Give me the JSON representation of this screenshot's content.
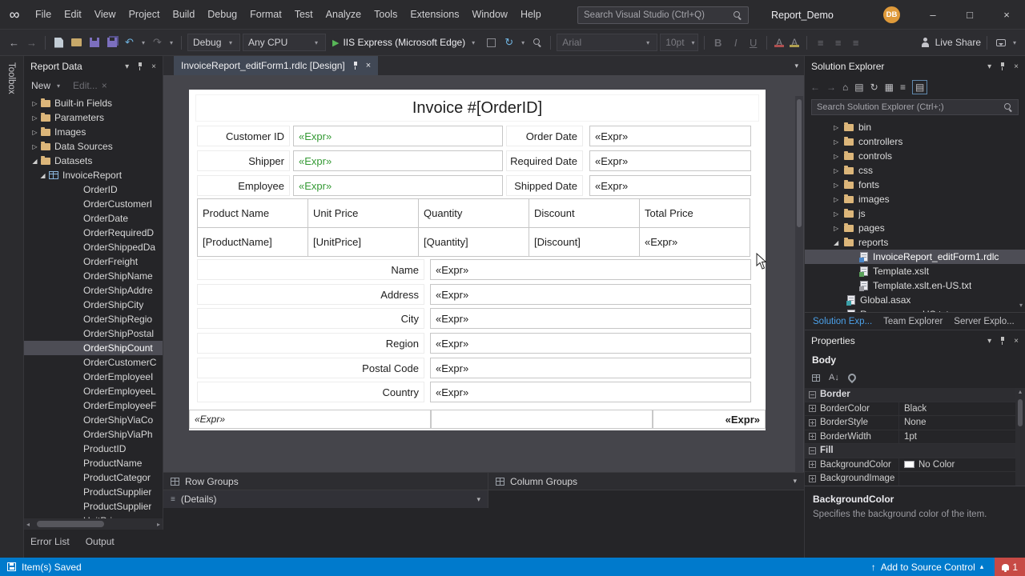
{
  "icons": {
    "dropdown": "▾",
    "dropdown_up": "▴",
    "run": "▶",
    "back": "←",
    "forward": "→",
    "undo": "↶",
    "redo": "↷",
    "refresh": "↻",
    "home": "⌂",
    "infinity": "∞",
    "close": "×",
    "minimize": "–",
    "maximize": "□",
    "collapsed": "▷",
    "expanded": "◢",
    "scroll_left": "◂",
    "scroll_right": "▸",
    "scroll_up": "▴",
    "scroll_down": "▾",
    "up_arrow": "↑",
    "lines": "≡",
    "sort_az": "A↓",
    "pending": "▤",
    "show_all": "▦"
  },
  "colors": {
    "accent": "#007acc",
    "expr_green": "#339933",
    "selection": "#4d4d55",
    "folder_yellow": "#dcb67a",
    "statusbar_blue": "#007acc",
    "notification_red": "#c74a45",
    "avatar_orange": "#df9a3a"
  },
  "titlebar": {
    "menus": [
      "File",
      "Edit",
      "View",
      "Project",
      "Build",
      "Debug",
      "Format",
      "Test",
      "Analyze",
      "Tools",
      "Extensions",
      "Window",
      "Help"
    ],
    "search_placeholder": "Search Visual Studio (Ctrl+Q)",
    "window_title": "Report_Demo",
    "avatar_initials": "DB"
  },
  "toolbar": {
    "debug_target": "Debug",
    "platform": "Any CPU",
    "run_button": "IIS Express (Microsoft Edge)",
    "font_family": "Arial",
    "font_size": "10pt",
    "bold": "B",
    "italic": "I",
    "underline": "U",
    "live_share": "Live Share"
  },
  "toolbox_label": "Toolbox",
  "report_data": {
    "title": "Report Data",
    "toolbar": {
      "new": "New",
      "edit": "Edit..."
    },
    "folders": [
      {
        "label": "Built-in Fields"
      },
      {
        "label": "Parameters"
      },
      {
        "label": "Images"
      },
      {
        "label": "Data Sources"
      },
      {
        "label": "Datasets",
        "expanded": true
      }
    ],
    "dataset": {
      "label": "InvoiceReport"
    },
    "fields": [
      "OrderID",
      "OrderCustomerI",
      "OrderDate",
      "OrderRequiredD",
      "OrderShippedDa",
      "OrderFreight",
      "OrderShipName",
      "OrderShipAddre",
      "OrderShipCity",
      "OrderShipRegio",
      "OrderShipPostal",
      "OrderShipCount",
      "OrderCustomerC",
      "OrderEmployeeI",
      "OrderEmployeeL",
      "OrderEmployeeF",
      "OrderShipViaCo",
      "OrderShipViaPh",
      "ProductID",
      "ProductName",
      "ProductCategor",
      "ProductSupplier",
      "ProductSupplier",
      "UnitPrice"
    ],
    "selected_field": "OrderShipCount"
  },
  "bottom_tabs": [
    "Error List",
    "Output"
  ],
  "editor": {
    "tab": {
      "title": "InvoiceReport_editForm1.rdlc [Design]"
    },
    "report": {
      "title": "Invoice #[OrderID]",
      "info_rows": [
        {
          "label": "Customer ID",
          "value": "«Expr»",
          "label2": "Order Date",
          "value2": "«Expr»"
        },
        {
          "label": "Shipper",
          "value": "«Expr»",
          "label2": "Required Date",
          "value2": "«Expr»"
        },
        {
          "label": "Employee",
          "value": "«Expr»",
          "label2": "Shipped Date",
          "value2": "«Expr»"
        }
      ],
      "table": {
        "headers": [
          "Product Name",
          "Unit Price",
          "Quantity",
          "Discount",
          "Total Price"
        ],
        "row": [
          "[ProductName]",
          "[UnitPrice]",
          "[Quantity]",
          "[Discount]",
          "«Expr»"
        ]
      },
      "address_rows": [
        {
          "label": "Name",
          "value": "«Expr»"
        },
        {
          "label": "Address",
          "value": "«Expr»"
        },
        {
          "label": "City",
          "value": "«Expr»"
        },
        {
          "label": "Region",
          "value": "«Expr»"
        },
        {
          "label": "Postal Code",
          "value": "«Expr»"
        },
        {
          "label": "Country",
          "value": "«Expr»"
        }
      ],
      "footer": {
        "left": "«Expr»",
        "right": "«Expr»"
      }
    },
    "groups_panel": {
      "row_groups": "Row Groups",
      "column_groups": "Column Groups",
      "row_items": [
        "(Details)"
      ]
    }
  },
  "solution_explorer": {
    "title": "Solution Explorer",
    "search_placeholder": "Search Solution Explorer (Ctrl+;)",
    "tree": [
      {
        "label": "bin",
        "kind": "folder"
      },
      {
        "label": "controllers",
        "kind": "folder"
      },
      {
        "label": "controls",
        "kind": "folder"
      },
      {
        "label": "css",
        "kind": "folder"
      },
      {
        "label": "fonts",
        "kind": "folder"
      },
      {
        "label": "images",
        "kind": "folder"
      },
      {
        "label": "js",
        "kind": "folder"
      },
      {
        "label": "pages",
        "kind": "folder"
      },
      {
        "label": "reports",
        "kind": "folder",
        "expanded": true
      },
      {
        "label": "InvoiceReport_editForm1.rdlc",
        "kind": "file-rdlc",
        "indent": 1,
        "selected": true
      },
      {
        "label": "Template.xslt",
        "kind": "file-xslt",
        "indent": 1
      },
      {
        "label": "Template.xslt.en-US.txt",
        "kind": "file-txt",
        "indent": 1
      },
      {
        "label": "Global.asax",
        "kind": "file-asax"
      },
      {
        "label": "Resources.en-US.txt",
        "kind": "file-txt"
      }
    ],
    "tabs": [
      {
        "label": "Solution Exp...",
        "active": true
      },
      {
        "label": "Team Explorer"
      },
      {
        "label": "Server Explo..."
      }
    ]
  },
  "properties": {
    "title": "Properties",
    "object_name": "Body",
    "rows": [
      {
        "kind": "category",
        "label": "Border"
      },
      {
        "kind": "prop",
        "label": "BorderColor",
        "value": "Black"
      },
      {
        "kind": "prop",
        "label": "BorderStyle",
        "value": "None"
      },
      {
        "kind": "prop",
        "label": "BorderWidth",
        "value": "1pt"
      },
      {
        "kind": "category",
        "label": "Fill"
      },
      {
        "kind": "prop",
        "label": "BackgroundColor",
        "value": "No Color",
        "swatch": true
      },
      {
        "kind": "prop",
        "label": "BackgroundImage",
        "value": ""
      }
    ],
    "description_title": "BackgroundColor",
    "description_text": "Specifies the background color of the item."
  },
  "statusbar": {
    "message": "Item(s) Saved",
    "add_to_source_control": "Add to Source Control",
    "notification_count": "1"
  }
}
